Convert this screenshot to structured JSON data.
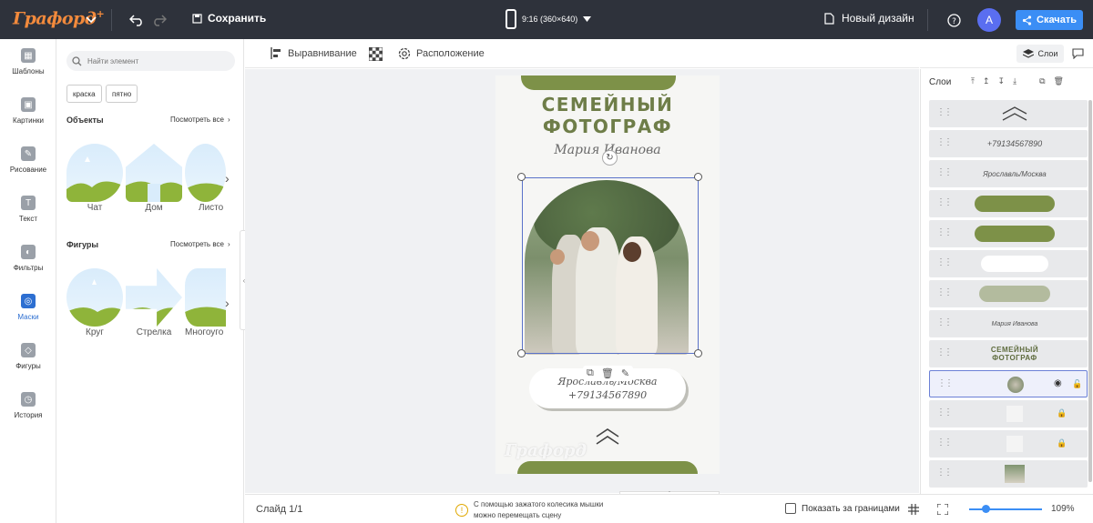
{
  "topbar": {
    "logo": "Графорд",
    "save_label": "Сохранить",
    "format_label": "9:16 (360×640)",
    "new_design_label": "Новый дизайн",
    "avatar_letter": "A",
    "download_label": "Скачать"
  },
  "rail": {
    "items": [
      {
        "label": "Шаблоны",
        "icon": "templates-icon"
      },
      {
        "label": "Картинки",
        "icon": "image-icon"
      },
      {
        "label": "Рисование",
        "icon": "pencil-icon"
      },
      {
        "label": "Текст",
        "icon": "text-icon"
      },
      {
        "label": "Фильтры",
        "icon": "filter-icon"
      },
      {
        "label": "Маски",
        "icon": "mask-icon",
        "active": true
      },
      {
        "label": "Фигуры",
        "icon": "shapes-icon"
      },
      {
        "label": "История",
        "icon": "history-icon"
      }
    ]
  },
  "panel": {
    "search_placeholder": "Найти элемент",
    "tags": [
      "краска",
      "пятно"
    ],
    "objects_title": "Объекты",
    "objects_see_all": "Посмотреть все",
    "objects": [
      "Чат",
      "Дом",
      "Листо"
    ],
    "shapes_title": "Фигуры",
    "shapes_see_all": "Посмотреть все",
    "shapes": [
      "Круг",
      "Стрелка",
      "Многоуго"
    ]
  },
  "canvas_toolbar": {
    "align_label": "Выравнивание",
    "position_label": "Расположение"
  },
  "artboard": {
    "title_line1": "СЕМЕЙНЫЙ",
    "title_line2": "ФОТОГРАФ",
    "name": "Мария Иванова",
    "city": "Ярославль/Москва",
    "phone": "+79134567890",
    "watermark": "Графорд",
    "accent_color": "#7d9148"
  },
  "bottombar": {
    "slide_label": "Слайд 1/1",
    "hint_line1": "С помощью зажатого колесика мышки",
    "hint_line2": "можно перемещать сцену",
    "show_bounds_label": "Показать за границами",
    "zoom": "109%"
  },
  "layers": {
    "tab_label": "Слои",
    "title": "Слои",
    "items": [
      {
        "kind": "chevron"
      },
      {
        "kind": "text",
        "text": "+79134567890"
      },
      {
        "kind": "text",
        "text": "Ярославль/Москва"
      },
      {
        "kind": "pill",
        "color": "#7d9148"
      },
      {
        "kind": "pill",
        "color": "#7d9148"
      },
      {
        "kind": "pill",
        "color": "#ffffff"
      },
      {
        "kind": "pill",
        "color": "#b3bb9e"
      },
      {
        "kind": "text",
        "text": "Мария Иванова"
      },
      {
        "kind": "title",
        "text1": "СЕМЕЙНЫЙ",
        "text2": "ФОТОГРАФ"
      },
      {
        "kind": "photo",
        "selected": true
      },
      {
        "kind": "blank",
        "locked": true
      },
      {
        "kind": "blank",
        "locked": true
      },
      {
        "kind": "photo2"
      }
    ]
  }
}
